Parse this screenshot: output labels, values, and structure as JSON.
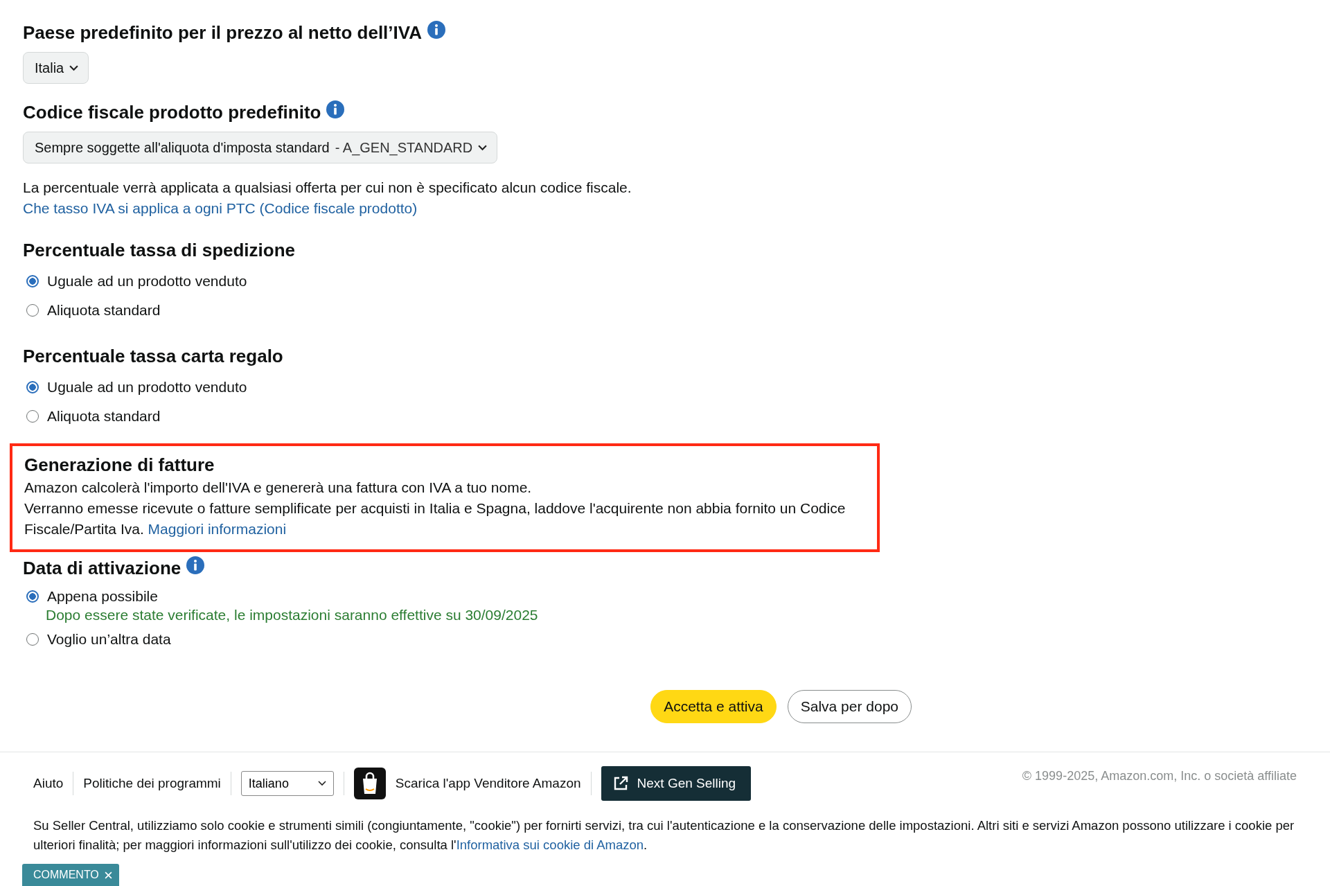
{
  "vat_country": {
    "heading": "Paese predefinito per il prezzo al netto dell’IVA",
    "info": true,
    "select": "Italia"
  },
  "tax_code": {
    "heading": "Codice fiscale prodotto predefinito",
    "info": true,
    "select": "Sempre soggette all'aliquota d'imposta standard",
    "select_suffix": "- A_GEN_STANDARD",
    "note": "La percentuale verrà applicata a qualsiasi offerta per cui non è specificato alcun codice fiscale.",
    "note_link": "Che tasso IVA si applica a ogni PTC (Codice fiscale prodotto)"
  },
  "radio_groups": [
    {
      "heading": "Percentuale tassa di spedizione",
      "info": false,
      "options": [
        {
          "label": "Uguale ad un prodotto venduto",
          "selected": true
        },
        {
          "label": "Aliquota standard",
          "selected": false
        }
      ]
    },
    {
      "heading": "Percentuale tassa carta regalo",
      "info": false,
      "options": [
        {
          "label": "Uguale ad un prodotto venduto",
          "selected": true
        },
        {
          "label": "Aliquota standard",
          "selected": false
        }
      ]
    }
  ],
  "invoice": {
    "heading": "Generazione di fatture",
    "highlighted": true,
    "lines": [
      "Amazon calcolerà l'importo dell'IVA e genererà una fattura con IVA a tuo nome.",
      "Verranno emesse ricevute o fatture semplificate per acquisti in Italia e Spagna, laddove l'acquirente non abbia fornito un Codice Fiscale/Partita Iva."
    ],
    "link": "Maggiori informazioni"
  },
  "activation": {
    "heading": "Data di attivazione",
    "info": true,
    "options": [
      {
        "label": "Appena possibile",
        "selected": true,
        "note": "Dopo essere state verificate, le impostazioni saranno effettive su 30/09/2025"
      },
      {
        "label": "Voglio un’altra data",
        "selected": false
      }
    ]
  },
  "buttons": [
    {
      "label": "Accetta e attiva",
      "kind": "primary"
    },
    {
      "label": "Salva per dopo",
      "kind": "secondary"
    }
  ],
  "footer": {
    "links": [
      "Aiuto",
      "Politiche dei programmi"
    ],
    "language": "Italiano",
    "app_link": "Scarica l'app Venditore Amazon",
    "next_gen": "Next Gen Selling",
    "copyright": "© 1999-2025, Amazon.com, Inc. o società affiliate",
    "cookie_text": "Su Seller Central, utilizziamo solo cookie e strumenti simili (congiuntamente, \"cookie\") per fornirti servizi, tra cui l'autenticazione e la conservazione delle impostazioni. Altri siti e servizi Amazon possono utilizzare i cookie per ulteriori finalità; per maggiori informazioni sull'utilizzo dei cookie, consulta l'",
    "cookie_link": "Informativa sui cookie di Amazon",
    "cookie_end": "."
  },
  "feedback_tab": "COMMENTO"
}
